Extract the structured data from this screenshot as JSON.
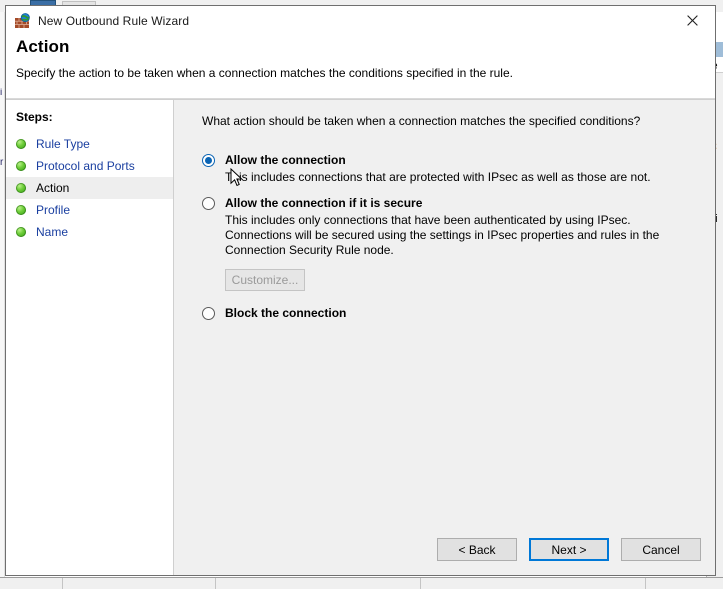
{
  "window": {
    "title": "New Outbound Rule Wizard",
    "icon": "firewall-rule-icon",
    "close_label": "✕"
  },
  "header": {
    "title": "Action",
    "subtitle": "Specify the action to be taken when a connection matches the conditions specified in the rule."
  },
  "sidebar": {
    "title": "Steps:",
    "items": [
      {
        "label": "Rule Type",
        "current": false
      },
      {
        "label": "Protocol and Ports",
        "current": false
      },
      {
        "label": "Action",
        "current": true
      },
      {
        "label": "Profile",
        "current": false
      },
      {
        "label": "Name",
        "current": false
      }
    ]
  },
  "main": {
    "question": "What action should be taken when a connection matches the specified conditions?",
    "options": [
      {
        "id": "allow",
        "label": "Allow the connection",
        "description": "This includes connections that are protected with IPsec as well as those are not.",
        "selected": true
      },
      {
        "id": "allow-secure",
        "label": "Allow the connection if it is secure",
        "description": "This includes only connections that have been authenticated by using IPsec.  Connections will be secured using the settings in IPsec properties and rules in the Connection Security Rule node.",
        "selected": false,
        "customize_label": "Customize...",
        "customize_enabled": false
      },
      {
        "id": "block",
        "label": "Block the connection",
        "description": "",
        "selected": false
      }
    ]
  },
  "footer": {
    "back_label": "< Back",
    "next_label": "Next >",
    "cancel_label": "Cancel",
    "default_button": "next"
  },
  "colors": {
    "accent": "#0078d7",
    "radio_selected": "#0a64b4",
    "link": "#1a3fa0",
    "content_bg": "#f0f0f0",
    "bullet_green": "#6fce3a"
  },
  "background": {
    "left_sliver_rows": [
      "i",
      "r"
    ],
    "right_rows": [
      "u",
      "le",
      "I",
      "S",
      "C",
      "Li"
    ],
    "bottom_text": " "
  }
}
